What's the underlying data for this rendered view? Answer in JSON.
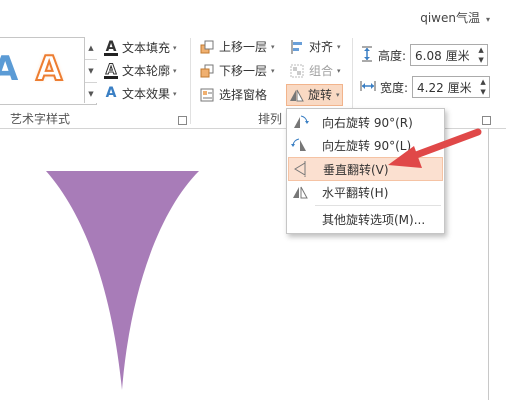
{
  "header": {
    "user_name": "qiwen气温",
    "caret": "▾"
  },
  "wordart": {
    "sample_letter_1": "A",
    "sample_letter_2": "A",
    "group_label": "艺术字样式",
    "text_fill": "文本填充",
    "text_outline": "文本轮廓",
    "text_effects": "文本效果",
    "dropdown": "▾"
  },
  "arrange": {
    "bring_forward": "上移一层",
    "send_backward": "下移一层",
    "selection_pane": "选择窗格",
    "align": "对齐",
    "group": "组合",
    "rotate": "旋转",
    "group_label": "排列",
    "dropdown": "▾"
  },
  "size": {
    "height_label": "高度:",
    "height_value": "6.08 厘米",
    "width_label": "宽度:",
    "width_value": "4.22 厘米"
  },
  "rotate_menu": {
    "items": [
      {
        "label": "向右旋转 90°(R)",
        "icon": "rotate-right-icon"
      },
      {
        "label": "向左旋转 90°(L)",
        "icon": "rotate-left-icon"
      },
      {
        "label": "垂直翻转(V)",
        "icon": "flip-vertical-icon"
      },
      {
        "label": "水平翻转(H)",
        "icon": "flip-horizontal-icon"
      }
    ],
    "more": "其他旋转选项(M)..."
  },
  "colors": {
    "shape_fill": "#a87cb8",
    "arrow": "#e04848",
    "highlight": "#fbe0d0",
    "accent_orange": "#ed7d31"
  }
}
